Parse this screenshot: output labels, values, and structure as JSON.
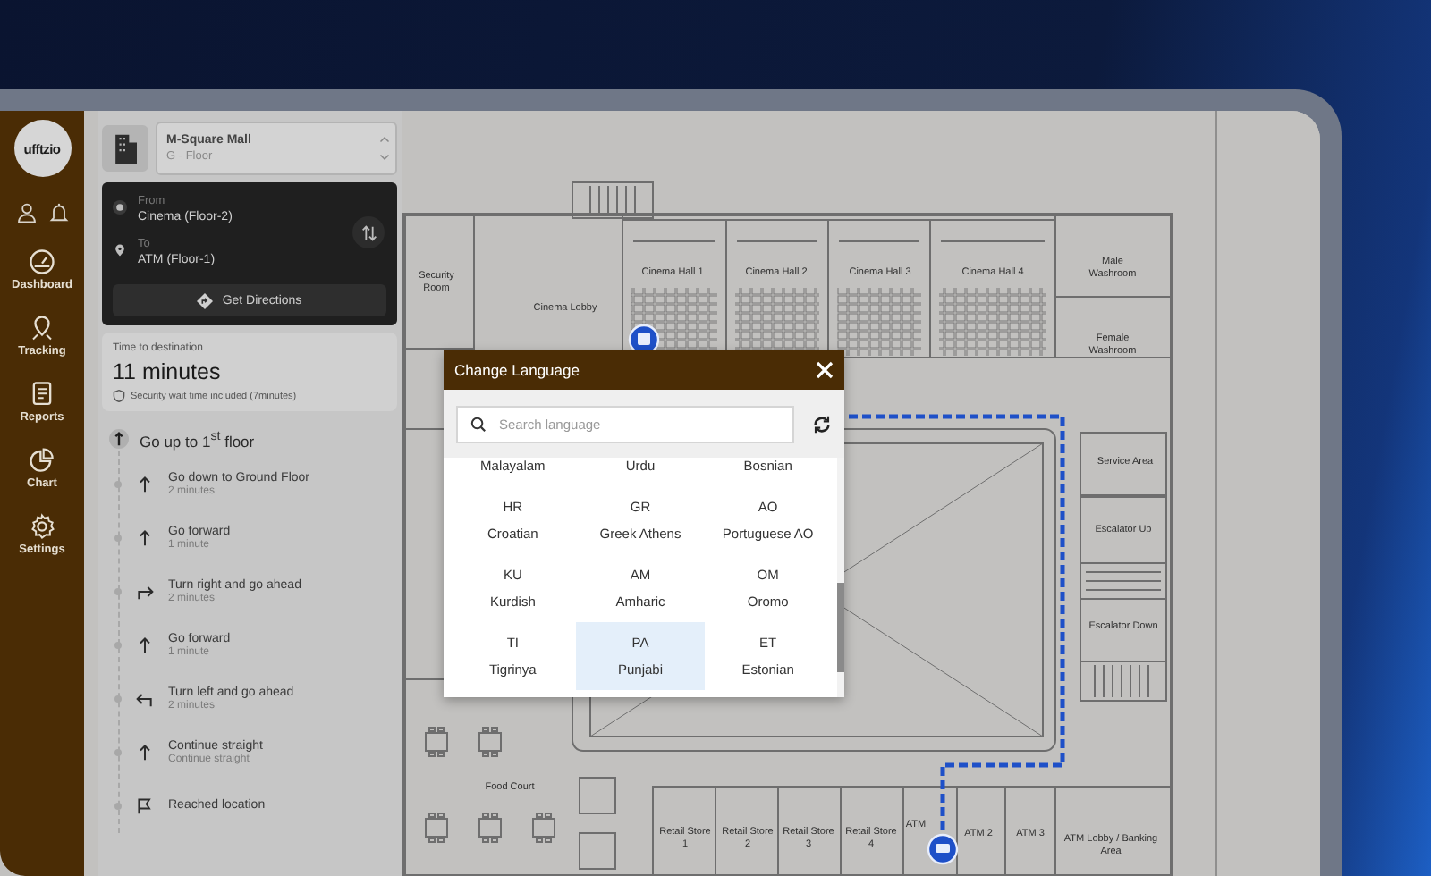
{
  "sidebar": {
    "logo": "ufftzio",
    "nav": [
      {
        "label": "Dashboard"
      },
      {
        "label": "Tracking"
      },
      {
        "label": "Reports"
      },
      {
        "label": "Chart"
      },
      {
        "label": "Settings"
      }
    ]
  },
  "panel": {
    "building": {
      "name": "M-Square Mall",
      "floor": "G - Floor"
    },
    "route": {
      "from_label": "From",
      "from": "Cinema (Floor-2)",
      "to_label": "To",
      "to": "ATM (Floor-1)",
      "button": "Get Directions"
    },
    "time": {
      "label": "Time to destination",
      "value": "11 minutes",
      "note": "Security wait time included (7minutes)"
    },
    "steps_title": "Go up to 1$^{st}$ floor",
    "steps": [
      {
        "kind": "up",
        "title": "Go down to Ground Floor",
        "subtitle": "2 minutes"
      },
      {
        "kind": "up",
        "title": "Go forward",
        "subtitle": "1 minute"
      },
      {
        "kind": "right",
        "title": "Turn right and go ahead",
        "subtitle": "2 minutes"
      },
      {
        "kind": "up",
        "title": "Go forward",
        "subtitle": "1 minute"
      },
      {
        "kind": "left",
        "title": "Turn left and go ahead",
        "subtitle": "2 minutes"
      },
      {
        "kind": "up",
        "title": "Continue straight",
        "subtitle": "Continue straight"
      },
      {
        "kind": "flag",
        "title": "Reached location"
      }
    ]
  },
  "map": {
    "rooms": [
      {
        "label": "Security Room"
      },
      {
        "label": "Cinema Lobby"
      },
      {
        "label": "Cinema Hall 1"
      },
      {
        "label": "Cinema Hall 2"
      },
      {
        "label": "Cinema Hall 3"
      },
      {
        "label": "Cinema Hall 4"
      },
      {
        "label": "Male Washroom"
      },
      {
        "label": "Female Washroom"
      },
      {
        "label": "Service Area"
      },
      {
        "label": "Escalator Up"
      },
      {
        "label": "Escalator Down"
      },
      {
        "label": "Food Court"
      },
      {
        "label": "Retail Store 1"
      },
      {
        "label": "Retail Store 2"
      },
      {
        "label": "Retail Store 3"
      },
      {
        "label": "Retail Store 4"
      },
      {
        "label": "ATM"
      },
      {
        "label": "ATM 2"
      },
      {
        "label": "ATM 3"
      },
      {
        "label": "ATM Lobby / Banking Area"
      }
    ]
  },
  "dialog": {
    "title": "Change Language",
    "search": {
      "placeholder": "Search language"
    },
    "languages": [
      {
        "name": "Malayalam",
        "selected": false
      },
      {
        "name": "Urdu",
        "selected": false
      },
      {
        "name": "Bosnian",
        "selected": false
      },
      {
        "code": "HR",
        "name": "Croatian",
        "selected": false
      },
      {
        "code": "GR",
        "name": "Greek Athens",
        "selected": false
      },
      {
        "code": "AO",
        "name": "Portuguese AO",
        "selected": false
      },
      {
        "code": "KU",
        "name": "Kurdish",
        "selected": false
      },
      {
        "code": "AM",
        "name": "Amharic",
        "selected": false
      },
      {
        "code": "OM",
        "name": "Oromo",
        "selected": false
      },
      {
        "code": "TI",
        "name": "Tigrinya",
        "selected": false
      },
      {
        "code": "PA",
        "name": "Punjabi",
        "selected": true
      },
      {
        "code": "ET",
        "name": "Estonian",
        "selected": false
      }
    ]
  }
}
